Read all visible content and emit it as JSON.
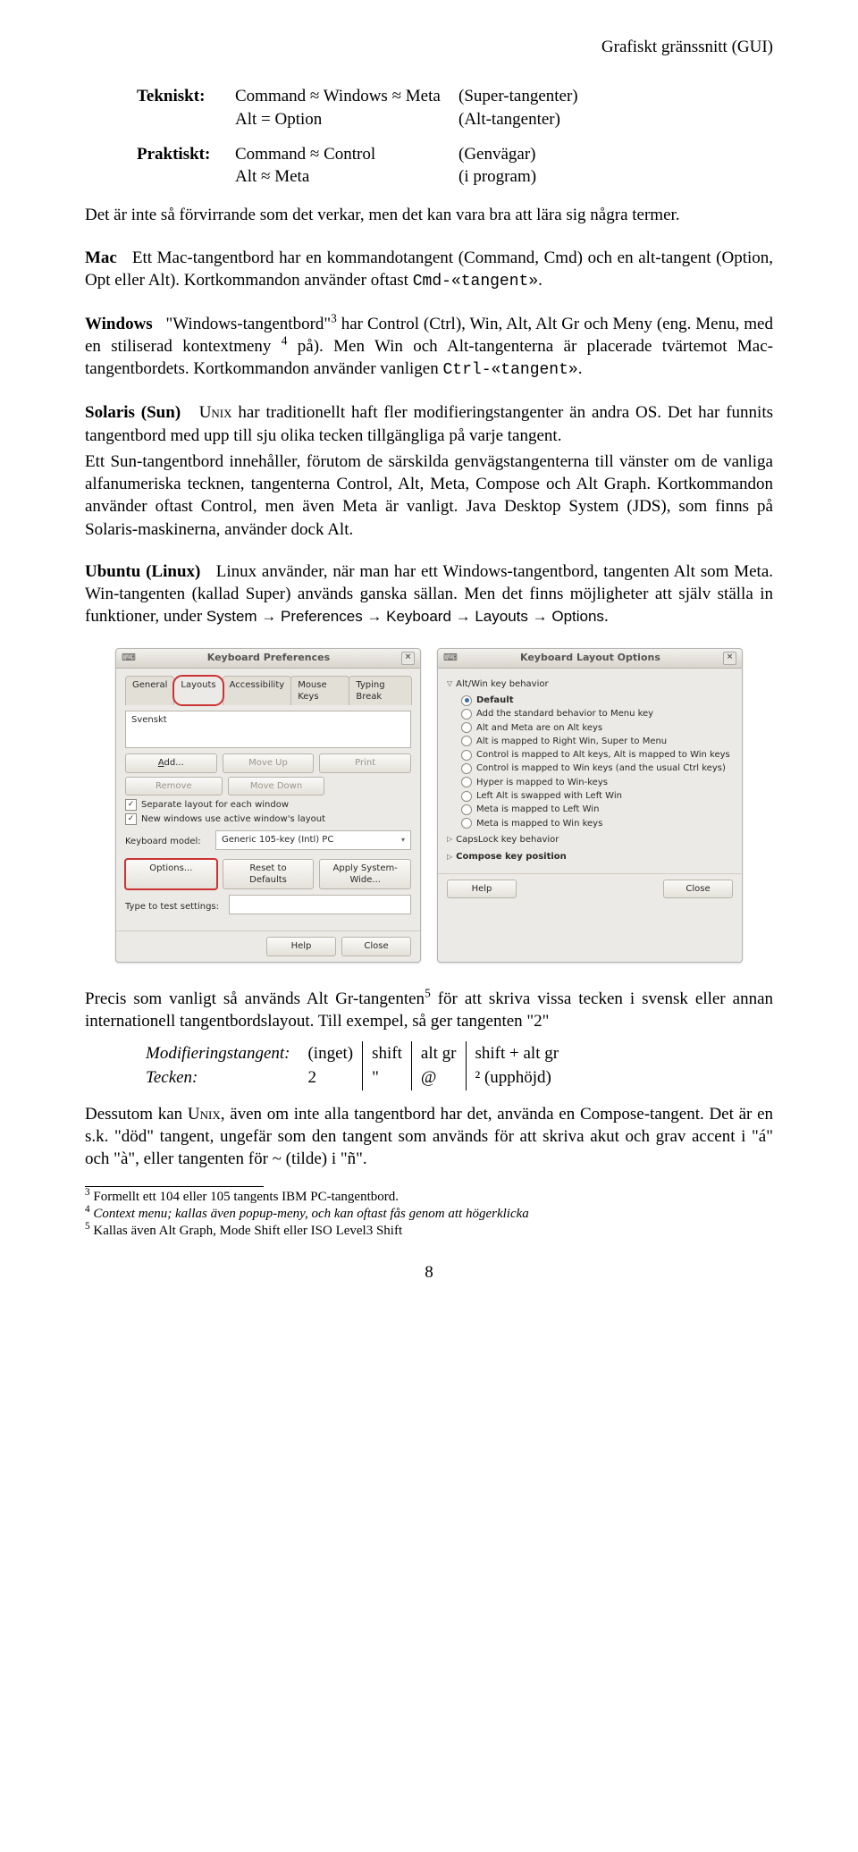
{
  "running_head": "Grafiskt gränssnitt (GUI)",
  "kv": {
    "tek_label": "Tekniskt:",
    "tek_a1": "Command ≈ Windows ≈ Meta",
    "tek_a2": "(Super-tangenter)",
    "tek_b1": "Alt = Option",
    "tek_b2": "(Alt-tangenter)",
    "pra_label": "Praktiskt:",
    "pra_a1": "Command ≈ Control",
    "pra_a2": "(Genvägar)",
    "pra_b1": "Alt ≈ Meta",
    "pra_b2": "(i program)"
  },
  "intro": "Det är inte så förvirrande som det verkar, men det kan vara bra att lära sig några termer.",
  "mac": {
    "head": "Mac",
    "body_a": "Ett Mac-tangentbord har en kommandotangent (Command, Cmd) och en alt-tangent (Option, Opt eller Alt). Kortkommandon använder oftast ",
    "code": "Cmd-«tangent»",
    "body_b": "."
  },
  "win": {
    "head": "Windows",
    "body_a": "\"Windows-tangentbord\"",
    "body_b": " har Control (Ctrl), Win, Alt, Alt Gr och Meny (eng. Menu, med en stiliserad kontextmeny ",
    "body_c": " på). Men Win och Alt-tangenterna är placerade tvärtemot Mac-tangentbordets. Kortkommandon använder vanligen ",
    "code": "Ctrl-«tangent»",
    "body_d": "."
  },
  "sun": {
    "head": "Solaris (Sun)",
    "p1a": "U",
    "p1a_sc": "nix",
    "p1b": " har traditionellt haft fler modifieringstangenter än andra OS. Det har funnits tangentbord med upp till sju olika tecken tillgängliga på varje tangent.",
    "p2": "Ett Sun-tangentbord innehåller, förutom de särskilda genvägstangenterna till vänster om de vanliga alfanumeriska tecknen, tangenterna Control, Alt, Meta, Compose och Alt Graph. Kortkommandon använder oftast Control, men även Meta är vanligt. Java Desktop System (JDS), som finns på Solaris-maskinerna, använder dock Alt."
  },
  "ubuntu": {
    "head": "Ubuntu (Linux)",
    "body_a": "Linux använder, när man har ett Windows-tangentbord, tangenten Alt som Meta. Win-tangenten (kallad Super) används ganska sällan. Men det finns möjligheter att själv ställa in funktioner, under ",
    "path": "System → Preferences → Keyboard → Layouts → Options",
    "body_b": "."
  },
  "dlg1": {
    "title": "Keyboard Preferences",
    "tabs": [
      "General",
      "Layouts",
      "Accessibility",
      "Mouse Keys",
      "Typing Break"
    ],
    "layout_val": "Svenskt",
    "btn_add": "Add...",
    "btn_moveup": "Move Up",
    "btn_print": "Print",
    "btn_remove": "Remove",
    "btn_movedown": "Move Down",
    "chk1": "Separate layout for each window",
    "chk2": "New windows use active window's layout",
    "kbmodel_lab": "Keyboard model:",
    "kbmodel_val": "Generic 105-key (Intl) PC",
    "btn_options": "Options...",
    "btn_reset": "Reset to Defaults",
    "btn_apply": "Apply System-Wide...",
    "typetest": "Type to test settings:",
    "btn_help": "Help",
    "btn_close": "Close"
  },
  "dlg2": {
    "title": "Keyboard Layout Options",
    "grp_alt": "Alt/Win key behavior",
    "opts": [
      "Default",
      "Add the standard behavior to Menu key",
      "Alt and Meta are on Alt keys",
      "Alt is mapped to Right Win, Super to Menu",
      "Control is mapped to Alt keys, Alt is mapped to Win keys",
      "Control is mapped to Win keys (and the usual Ctrl keys)",
      "Hyper is mapped to Win-keys",
      "Left Alt is swapped with Left Win",
      "Meta is mapped to Left Win",
      "Meta is mapped to Win keys"
    ],
    "grp_caps": "CapsLock key behavior",
    "grp_compose": "Compose key position",
    "btn_help": "Help",
    "btn_close": "Close"
  },
  "altgr": {
    "p1": "Precis som vanligt så används Alt Gr-tangenten",
    "p1b": " för att skriva vissa tecken i svensk eller annan internationell tangentbordslayout. Till exempel, så ger tangenten \"2\""
  },
  "modtable": {
    "r1": [
      "Modifieringstangent:",
      "(inget)",
      "shift",
      "alt gr",
      "shift + alt gr"
    ],
    "r2": [
      "Tecken:",
      "2",
      "\"",
      "@",
      "² (upphöjd)"
    ]
  },
  "compose": {
    "a": "Dessutom kan U",
    "a_sc": "nix",
    "b": ", även om inte alla tangentbord har det, använda en Compose-tangent. Det är en s.k. \"död\" tangent, ungefär som den tangent som används för att skriva akut och grav accent i \"á\" och \"à\", eller tangenten för ~ (tilde) i \"ñ\"."
  },
  "fn3": "Formellt ett 104 eller 105 tangents IBM PC-tangentbord.",
  "fn4": "Context menu; kallas även popup-meny, och kan oftast fås genom att högerklicka",
  "fn5": "Kallas även Alt Graph, Mode Shift eller ISO Level3 Shift",
  "pagenum": "8"
}
